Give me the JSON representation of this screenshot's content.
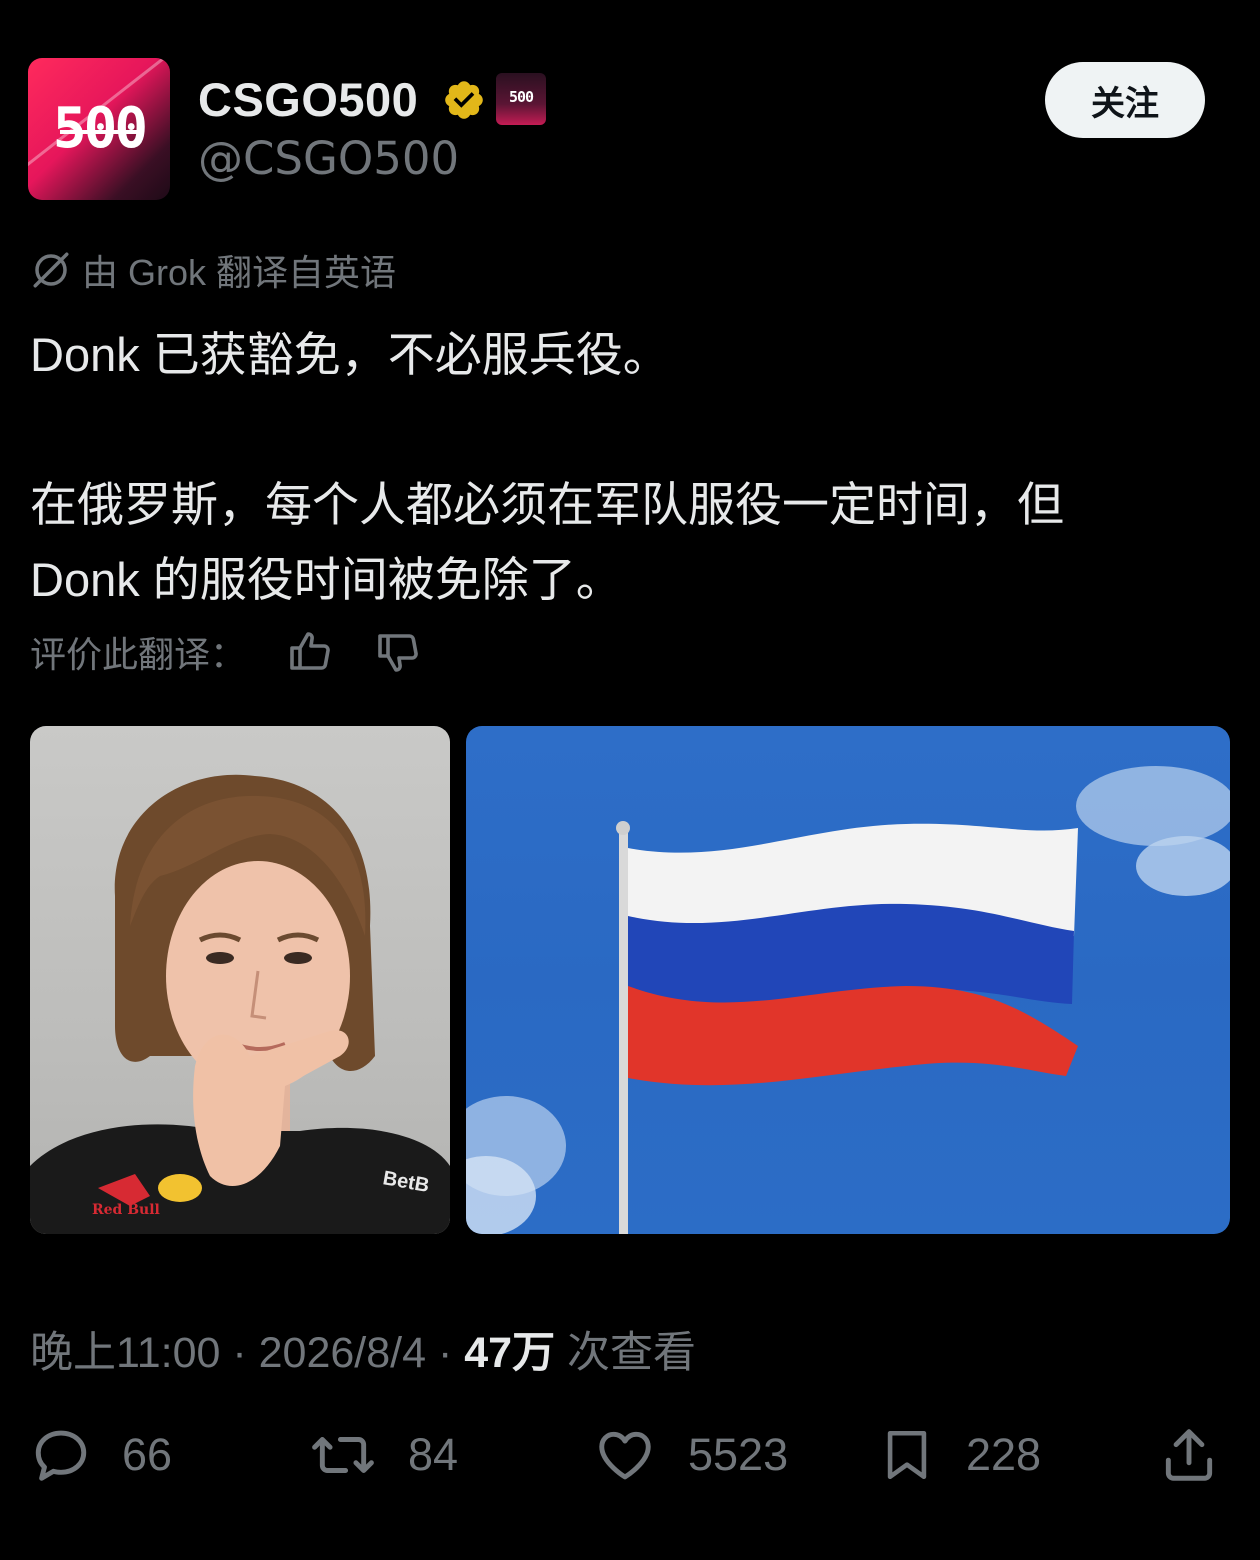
{
  "user": {
    "avatar_text": "500",
    "display_name": "CSGO500",
    "handle": "@CSGO500",
    "badge_text": "500",
    "verified_icon": "verified-badge-icon"
  },
  "follow_label": "关注",
  "translation_note": "由 Grok 翻译自英语",
  "tweet": {
    "line1": "Donk 已获豁免，不必服兵役。",
    "line2": "在俄罗斯，每个人都必须在军队服役一定时间，但",
    "line3": "Donk 的服役时间被免除了。"
  },
  "rate_label": "评价此翻译：",
  "images": {
    "left_shirt_text": "BetB",
    "left_logo_text": "Red Bull"
  },
  "meta": {
    "time": "晚上11:00",
    "sep1": " · ",
    "date": "2026/8/4",
    "sep2": " · ",
    "views": "47万",
    "views_label": " 次查看"
  },
  "actions": {
    "replies": "66",
    "reposts": "84",
    "likes": "5523",
    "bookmarks": "228"
  },
  "colors": {
    "background": "#000000",
    "text": "#e7e9ea",
    "muted": "#71767b",
    "verified": "#e2b719"
  }
}
